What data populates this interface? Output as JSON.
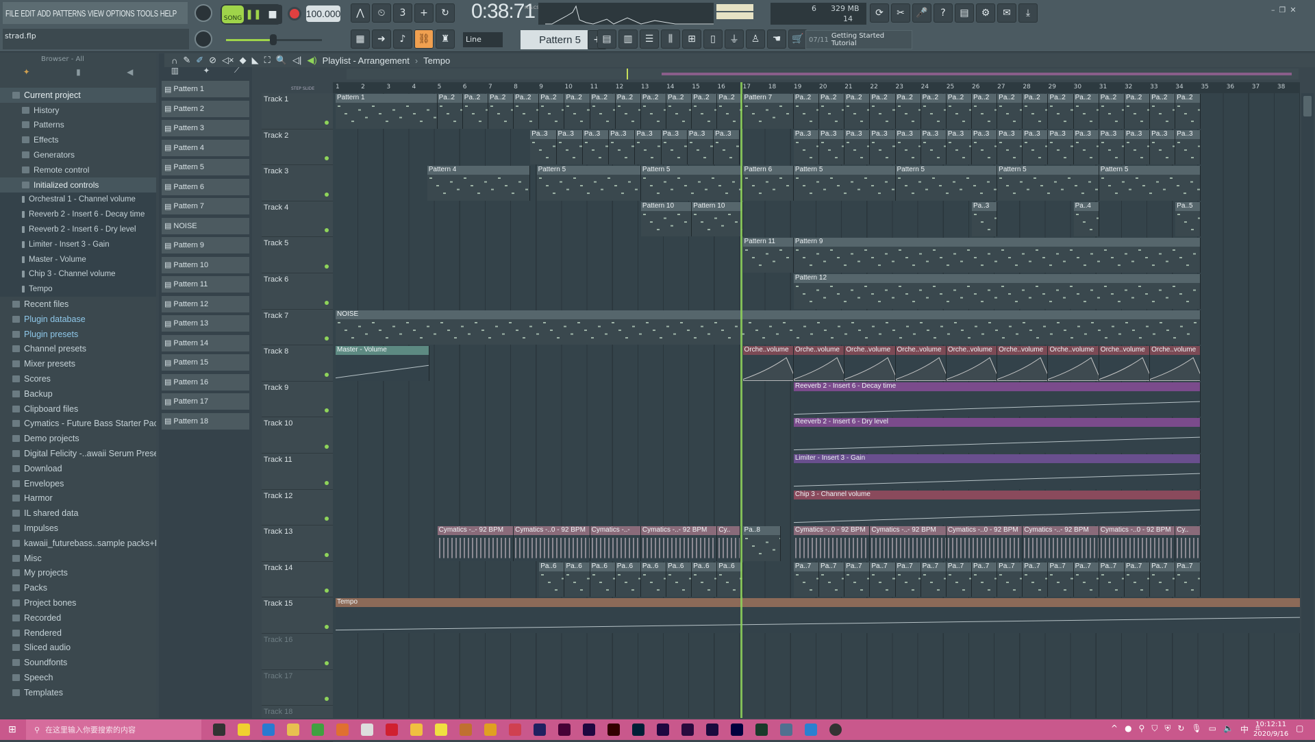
{
  "menu": [
    "FILE",
    "EDIT",
    "ADD",
    "PATTERNS",
    "VIEW",
    "OPTIONS",
    "TOOLS",
    "HELP"
  ],
  "hint": "strad.flp",
  "transport": {
    "pat": "PAT",
    "song": "SONG",
    "tempo": "100.000",
    "time": "0:38:71",
    "time_unit": "M:S:CS"
  },
  "cpu": {
    "value": "6",
    "memory": "329 MB",
    "polyphony": "14"
  },
  "snap": "Line",
  "pattern_selector": "Pattern 5",
  "tutorial": {
    "step": "07/11",
    "label": "Getting Started Tutorial"
  },
  "browser": {
    "title": "Browser - All",
    "items": [
      {
        "label": "Current project",
        "level": 0,
        "hl": true
      },
      {
        "label": "History",
        "level": 1
      },
      {
        "label": "Patterns",
        "level": 1
      },
      {
        "label": "Effects",
        "level": 1
      },
      {
        "label": "Generators",
        "level": 1
      },
      {
        "label": "Remote control",
        "level": 1
      },
      {
        "label": "Initialized controls",
        "level": 1,
        "hl": true
      },
      {
        "label": "Orchestral 1 - Channel volume",
        "level": 2
      },
      {
        "label": "Reeverb 2 - Insert 6 - Decay time",
        "level": 2
      },
      {
        "label": "Reeverb 2 - Insert 6 - Dry level",
        "level": 2
      },
      {
        "label": "Limiter - Insert 3 - Gain",
        "level": 2
      },
      {
        "label": "Master - Volume",
        "level": 2
      },
      {
        "label": "Chip 3 - Channel volume",
        "level": 2
      },
      {
        "label": "Tempo",
        "level": 2
      },
      {
        "label": "Recent files",
        "level": 0
      },
      {
        "label": "Plugin database",
        "level": 0,
        "blue": true
      },
      {
        "label": "Plugin presets",
        "level": 0,
        "blue": true
      },
      {
        "label": "Channel presets",
        "level": 0
      },
      {
        "label": "Mixer presets",
        "level": 0
      },
      {
        "label": "Scores",
        "level": 0
      },
      {
        "label": "Backup",
        "level": 0
      },
      {
        "label": "Clipboard files",
        "level": 0
      },
      {
        "label": "Cymatics - Future Bass Starter Pack",
        "level": 0
      },
      {
        "label": "Demo projects",
        "level": 0
      },
      {
        "label": "Digital Felicity -..awaii Serum Presets",
        "level": 0
      },
      {
        "label": "Download",
        "level": 0
      },
      {
        "label": "Envelopes",
        "level": 0
      },
      {
        "label": "Harmor",
        "level": 0
      },
      {
        "label": "IL shared data",
        "level": 0
      },
      {
        "label": "Impulses",
        "level": 0
      },
      {
        "label": "kawaii_futurebass..sample packs+FLP",
        "level": 0
      },
      {
        "label": "Misc",
        "level": 0
      },
      {
        "label": "My projects",
        "level": 0
      },
      {
        "label": "Packs",
        "level": 0
      },
      {
        "label": "Project bones",
        "level": 0
      },
      {
        "label": "Recorded",
        "level": 0
      },
      {
        "label": "Rendered",
        "level": 0
      },
      {
        "label": "Sliced audio",
        "level": 0
      },
      {
        "label": "Soundfonts",
        "level": 0
      },
      {
        "label": "Speech",
        "level": 0
      },
      {
        "label": "Templates",
        "level": 0
      }
    ]
  },
  "patterns": [
    "Pattern 1",
    "Pattern 2",
    "Pattern 3",
    "Pattern 4",
    "Pattern 5",
    "Pattern 6",
    "Pattern 7",
    "NOISE",
    "Pattern 9",
    "Pattern 10",
    "Pattern 11",
    "Pattern 12",
    "Pattern 13",
    "Pattern 14",
    "Pattern 15",
    "Pattern 16",
    "Pattern 17",
    "Pattern 18"
  ],
  "playlist": {
    "title": "Playlist - Arrangement",
    "breadcrumb": "Tempo",
    "step_label": "STEP",
    "slide_label": "SLIDE",
    "bars": [
      1,
      2,
      3,
      4,
      5,
      6,
      7,
      8,
      9,
      10,
      11,
      12,
      13,
      14,
      15,
      16,
      17,
      18,
      19,
      20,
      21,
      22,
      23,
      24,
      25,
      26,
      27,
      28,
      29,
      30,
      31,
      32,
      33,
      34,
      35,
      36,
      37,
      38
    ],
    "playhead_bar": 16.9,
    "tracks": [
      "Track 1",
      "Track 2",
      "Track 3",
      "Track 4",
      "Track 5",
      "Track 6",
      "Track 7",
      "Track 8",
      "Track 9",
      "Track 10",
      "Track 11",
      "Track 12",
      "Track 13",
      "Track 14",
      "Track 15",
      "Track 16",
      "Track 17",
      "Track 18"
    ],
    "clips": [
      {
        "track": 1,
        "start": 1,
        "len": 4,
        "label": "Pattern 1",
        "type": "pattern"
      },
      {
        "track": 1,
        "start": 5,
        "len": 1,
        "repeat": 12,
        "label": "Pa..2",
        "type": "pattern"
      },
      {
        "track": 1,
        "start": 17,
        "len": 2,
        "label": "Pattern 7",
        "type": "pattern"
      },
      {
        "track": 1,
        "start": 19,
        "len": 1,
        "repeat": 16,
        "label": "Pa..2",
        "type": "pattern"
      },
      {
        "track": 2,
        "start": 8.65,
        "len": 1.03,
        "repeat": 8,
        "label": "Pa..3",
        "type": "pattern"
      },
      {
        "track": 2,
        "start": 19,
        "len": 1,
        "repeat": 16,
        "label": "Pa..3",
        "type": "pattern"
      },
      {
        "track": 3,
        "start": 4.6,
        "len": 4.05,
        "label": "Pattern 4",
        "type": "pattern"
      },
      {
        "track": 3,
        "start": 8.9,
        "len": 4.1,
        "label": "Pattern 5",
        "type": "pattern"
      },
      {
        "track": 3,
        "start": 13,
        "len": 4,
        "label": "Pattern 5",
        "type": "pattern"
      },
      {
        "track": 3,
        "start": 17,
        "len": 2,
        "label": "Pattern 6",
        "type": "pattern"
      },
      {
        "track": 3,
        "start": 19,
        "len": 4,
        "repeat": 4,
        "label": "Pattern 5",
        "type": "pattern"
      },
      {
        "track": 4,
        "start": 13,
        "len": 2,
        "label": "Pattern 10",
        "type": "pattern"
      },
      {
        "track": 4,
        "start": 15,
        "len": 2,
        "label": "Pattern 10",
        "type": "pattern"
      },
      {
        "track": 4,
        "start": 26,
        "len": 1,
        "label": "Pa..3",
        "type": "pattern"
      },
      {
        "track": 4,
        "start": 30,
        "len": 1,
        "label": "Pa..4",
        "type": "pattern"
      },
      {
        "track": 4,
        "start": 34,
        "len": 1,
        "label": "Pa..5",
        "type": "pattern"
      },
      {
        "track": 5,
        "start": 17,
        "len": 2,
        "label": "Pattern 11",
        "type": "pattern"
      },
      {
        "track": 5,
        "start": 19,
        "len": 16,
        "label": "Pattern 9",
        "type": "pattern"
      },
      {
        "track": 6,
        "start": 19,
        "len": 16,
        "label": "Pattern 12",
        "type": "pattern"
      },
      {
        "track": 7,
        "start": 1,
        "len": 34,
        "label": "NOISE",
        "type": "pattern"
      },
      {
        "track": 8,
        "start": 1,
        "len": 3.7,
        "label": "Master - Volume",
        "type": "auto-master"
      },
      {
        "track": 8,
        "start": 17,
        "len": 2,
        "repeat": 9,
        "label": "Orche..volume",
        "type": "auto-orch"
      },
      {
        "track": 9,
        "start": 19,
        "len": 16,
        "label": "Reeverb 2 - Insert 6 - Decay time",
        "type": "auto-rev"
      },
      {
        "track": 10,
        "start": 19,
        "len": 16,
        "label": "Reeverb 2 - Insert 6 - Dry level",
        "type": "auto-rev"
      },
      {
        "track": 11,
        "start": 19,
        "len": 16,
        "label": "Limiter - Insert 3 - Gain",
        "type": "auto-lim"
      },
      {
        "track": 12,
        "start": 19,
        "len": 16,
        "label": "Chip 3 - Channel volume",
        "type": "auto-chip"
      },
      {
        "track": 13,
        "start": 5,
        "len": 3,
        "label": "Cymatics -..- 92 BPM",
        "type": "audio"
      },
      {
        "track": 13,
        "start": 8,
        "len": 3,
        "label": "Cymatics -..0 - 92 BPM",
        "type": "audio"
      },
      {
        "track": 13,
        "start": 11,
        "len": 2,
        "label": "Cymatics -..-",
        "type": "audio"
      },
      {
        "track": 13,
        "start": 13,
        "len": 3,
        "label": "Cymatics -..- 92 BPM",
        "type": "audio"
      },
      {
        "track": 13,
        "start": 16,
        "len": 0.9,
        "label": "Cy..",
        "type": "audio"
      },
      {
        "track": 13,
        "start": 17,
        "len": 1.5,
        "label": "Pa..8",
        "type": "pattern"
      },
      {
        "track": 13,
        "start": 19,
        "len": 3,
        "label": "Cymatics -..0 - 92 BPM",
        "type": "audio"
      },
      {
        "track": 13,
        "start": 22,
        "len": 3,
        "label": "Cymatics -..- 92 BPM",
        "type": "audio"
      },
      {
        "track": 13,
        "start": 25,
        "len": 3,
        "label": "Cymatics -..0 - 92 BPM",
        "type": "audio"
      },
      {
        "track": 13,
        "start": 28,
        "len": 3,
        "label": "Cymatics -..- 92 BPM",
        "type": "audio"
      },
      {
        "track": 13,
        "start": 31,
        "len": 3,
        "label": "Cymatics -..0 - 92 BPM",
        "type": "audio"
      },
      {
        "track": 13,
        "start": 34,
        "len": 1,
        "label": "Cy..",
        "type": "audio"
      },
      {
        "track": 14,
        "start": 9,
        "len": 1,
        "repeat": 8,
        "label": "Pa..6",
        "type": "pattern"
      },
      {
        "track": 14,
        "start": 19,
        "len": 1,
        "repeat": 16,
        "label": "Pa..7",
        "type": "pattern"
      },
      {
        "track": 15,
        "start": 1,
        "len": 38,
        "label": "Tempo",
        "type": "auto-tempo"
      }
    ]
  },
  "colors": {
    "pattern": "#56666c",
    "audio": "#8a6b7a",
    "auto-master": "#5d8a82",
    "auto-orch": "#7c4a55",
    "auto-rev": "#7b4b8c",
    "auto-lim": "#694f8e",
    "auto-chip": "#8a4a5c",
    "auto-tempo": "#8c6a58",
    "playhead": "#8fd45a"
  },
  "taskbar": {
    "search_placeholder": "在这里输入你要搜索的内容",
    "ime": "中",
    "time": "10:12:11",
    "date": "2020/9/16"
  }
}
